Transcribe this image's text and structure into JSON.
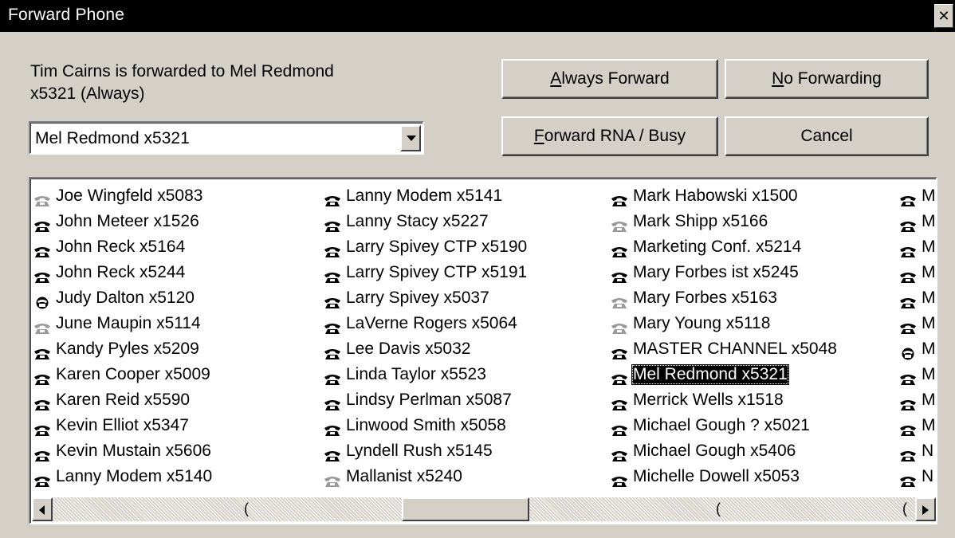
{
  "window": {
    "title": "Forward Phone",
    "close_glyph": "✕"
  },
  "status": {
    "text": "Tim Cairns is forwarded to Mel Redmond\nx5321 (Always)"
  },
  "combo": {
    "selected": "Mel Redmond x5321"
  },
  "buttons": {
    "always_forward": {
      "hotkey": "A",
      "rest": "lways Forward"
    },
    "no_forwarding": {
      "hotkey": "N",
      "rest": "o Forwarding"
    },
    "forward_rna": {
      "hotkey": "F",
      "rest": "orward RNA / Busy"
    },
    "cancel": {
      "label": "Cancel"
    }
  },
  "list": {
    "columns": [
      [
        {
          "label": "Joe Wingfeld x5083",
          "icon": "phone-icon-gray"
        },
        {
          "label": "John Meteer x1526",
          "icon": "phone-icon"
        },
        {
          "label": "John Reck x5164",
          "icon": "phone-icon"
        },
        {
          "label": "John Reck x5244",
          "icon": "phone-icon"
        },
        {
          "label": "Judy Dalton x5120",
          "icon": "phone-busy-icon"
        },
        {
          "label": "June Maupin x5114",
          "icon": "phone-icon-gray"
        },
        {
          "label": "Kandy Pyles x5209",
          "icon": "phone-icon"
        },
        {
          "label": "Karen Cooper x5009",
          "icon": "phone-icon"
        },
        {
          "label": "Karen Reid x5590",
          "icon": "phone-icon"
        },
        {
          "label": "Kevin Elliot x5347",
          "icon": "phone-icon"
        },
        {
          "label": "Kevin Mustain x5606",
          "icon": "phone-icon"
        },
        {
          "label": "Lanny Modem x5140",
          "icon": "phone-icon"
        }
      ],
      [
        {
          "label": "Lanny Modem x5141",
          "icon": "phone-icon"
        },
        {
          "label": "Lanny Stacy x5227",
          "icon": "phone-icon"
        },
        {
          "label": "Larry Spivey CTP x5190",
          "icon": "phone-icon"
        },
        {
          "label": "Larry Spivey CTP x5191",
          "icon": "phone-icon"
        },
        {
          "label": "Larry Spivey x5037",
          "icon": "phone-icon"
        },
        {
          "label": "LaVerne Rogers x5064",
          "icon": "phone-icon"
        },
        {
          "label": "Lee Davis x5032",
          "icon": "phone-icon"
        },
        {
          "label": "Linda Taylor x5523",
          "icon": "phone-icon"
        },
        {
          "label": "Lindsy Perlman x5087",
          "icon": "phone-icon"
        },
        {
          "label": "Linwood Smith x5058",
          "icon": "phone-icon"
        },
        {
          "label": "Lyndell Rush x5145",
          "icon": "phone-icon"
        },
        {
          "label": "Mallanist x5240",
          "icon": "phone-icon-gray"
        }
      ],
      [
        {
          "label": "Mark Habowski x1500",
          "icon": "phone-icon"
        },
        {
          "label": "Mark Shipp x5166",
          "icon": "phone-icon-gray"
        },
        {
          "label": "Marketing Conf. x5214",
          "icon": "phone-icon"
        },
        {
          "label": "Mary Forbes ist x5245",
          "icon": "phone-icon"
        },
        {
          "label": "Mary Forbes x5163",
          "icon": "phone-icon-gray"
        },
        {
          "label": "Mary Young x5118",
          "icon": "phone-icon-gray"
        },
        {
          "label": "MASTER CHANNEL x5048",
          "icon": "phone-icon"
        },
        {
          "label": "Mel Redmond x5321",
          "icon": "phone-icon",
          "selected": true
        },
        {
          "label": "Merrick Wells x1518",
          "icon": "phone-icon"
        },
        {
          "label": "Michael  Gough ? x5021",
          "icon": "phone-icon"
        },
        {
          "label": "Michael  Gough x5406",
          "icon": "phone-icon"
        },
        {
          "label": "Michelle Dowell x5053",
          "icon": "phone-icon"
        }
      ],
      [
        {
          "label": "M",
          "icon": "phone-icon"
        },
        {
          "label": "M",
          "icon": "phone-icon"
        },
        {
          "label": "M",
          "icon": "phone-icon"
        },
        {
          "label": "M",
          "icon": "phone-icon"
        },
        {
          "label": "M",
          "icon": "phone-icon"
        },
        {
          "label": "M",
          "icon": "phone-icon"
        },
        {
          "label": "M",
          "icon": "phone-busy-icon"
        },
        {
          "label": "M",
          "icon": "phone-icon"
        },
        {
          "label": "M",
          "icon": "phone-icon"
        },
        {
          "label": "M",
          "icon": "phone-icon"
        },
        {
          "label": "N",
          "icon": "phone-icon"
        },
        {
          "label": "N",
          "icon": "phone-icon"
        }
      ]
    ]
  },
  "colors": {
    "titlebar": "#000000",
    "face": "#d4d0c8",
    "phone_dark": "#000000",
    "phone_gray": "#9a9a9a"
  }
}
